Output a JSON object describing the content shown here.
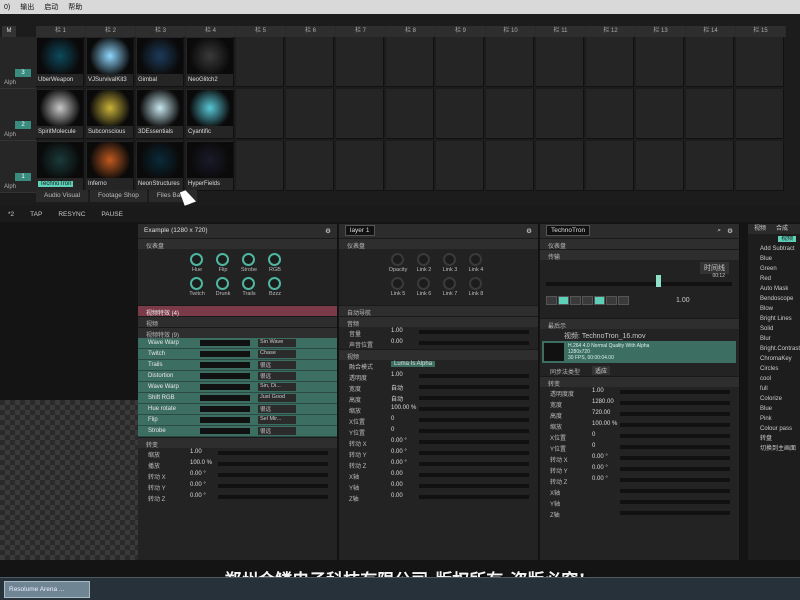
{
  "menubar": [
    "0)",
    "输出",
    "启动",
    "帮助"
  ],
  "grid": {
    "layer_label_M": "M",
    "columns": [
      "栏 1",
      "栏 2",
      "栏 3",
      "栏 4",
      "栏 5",
      "栏 6",
      "栏 7",
      "栏 8",
      "栏 9",
      "栏 10",
      "栏 11",
      "栏 12",
      "栏 13",
      "栏 14",
      "栏 15"
    ],
    "layers": [
      {
        "num": "3",
        "name": "Alph",
        "clips": [
          "UberWeapon",
          "VJSurvivalKit3",
          "Gimbal",
          "NeoGlitch2"
        ]
      },
      {
        "num": "2",
        "name": "Alph",
        "clips": [
          "SpiritMolecule",
          "Subconscious",
          "3DEssentials",
          "Cyantific"
        ]
      },
      {
        "num": "1",
        "name": "Alph",
        "clips": [
          "TechnoTron",
          "Inferno",
          "NeonStructures",
          "HyperFields"
        ]
      }
    ],
    "bottom_tabs": [
      "Audio Visual",
      "Footage Shop",
      "Files Bac..."
    ],
    "selected_clip": "TechnoTron",
    "hover_clip": "HyperFields"
  },
  "transport": {
    "bpm": "*2",
    "tap": "TAP",
    "resync": "RESYNC",
    "pause": "PAUSE"
  },
  "comp_panel": {
    "title": "Example (1280 x 720)",
    "dashboard": "仪表盘",
    "knobs": [
      "Hue",
      "Flip",
      "Strobe",
      "RGB",
      "Twitch",
      "Drunk",
      "Trails",
      "Bzzz"
    ],
    "sect_video_fx": "视频特效 (4)",
    "sect_video": "视频",
    "sect_fx9": "视频特效 (9)",
    "effects": [
      {
        "name": "Wave Warp",
        "val": "Sin Wave"
      },
      {
        "name": "Twitch",
        "val": "Chase"
      },
      {
        "name": "Trails",
        "val": "很远"
      },
      {
        "name": "Distortion",
        "val": "很远"
      },
      {
        "name": "Wave Warp",
        "val": "Sin, Di..."
      },
      {
        "name": "Shift RGB",
        "val": "Just Good"
      },
      {
        "name": "Hue rotate",
        "val": "很远"
      },
      {
        "name": "Flip",
        "val": "Sel Mir..."
      },
      {
        "name": "Strobe",
        "val": "很远"
      }
    ],
    "transform": "转变",
    "params": [
      {
        "k": "缩放",
        "v": "1.00"
      },
      {
        "k": "播放",
        "v": "100.0 %"
      },
      {
        "k": "转动 X",
        "v": "0.00 °"
      },
      {
        "k": "转动 Y",
        "v": "0.00 °"
      },
      {
        "k": "转动 Z",
        "v": "0.00 °"
      }
    ]
  },
  "layer_panel": {
    "title": "layer 1",
    "dashboard": "仪表盘",
    "links": [
      "Opacity",
      "Link 2",
      "Link 3",
      "Link 4",
      "Link 5",
      "Link 6",
      "Link 7",
      "Link 8"
    ],
    "sect_auto": "自动导航",
    "sect_audio": "音频",
    "audio": [
      {
        "k": "音量",
        "v": "1.00"
      },
      {
        "k": "声音位置",
        "v": "0.00"
      }
    ],
    "sect_video": "视频",
    "blend_label": "融合模式",
    "blend_val": "Luma Is Alpha",
    "video": [
      {
        "k": "透明度",
        "v": "1.00"
      },
      {
        "k": "宽度",
        "v": "自动"
      },
      {
        "k": "高度",
        "v": "自动"
      },
      {
        "k": "缩放",
        "v": "100.00 %"
      },
      {
        "k": "X位置",
        "v": "0"
      },
      {
        "k": "Y位置",
        "v": "0"
      },
      {
        "k": "转动 X",
        "v": "0.00 °"
      },
      {
        "k": "转动 Y",
        "v": "0.00 °"
      },
      {
        "k": "转动 Z",
        "v": "0.00 °"
      },
      {
        "k": "X轴",
        "v": "0.00"
      },
      {
        "k": "Y轴",
        "v": "0.00"
      },
      {
        "k": "Z轴",
        "v": "0.00"
      }
    ]
  },
  "clip_panel": {
    "title": "TechnoTron",
    "dashboard": "仪表盘",
    "transport": "传输",
    "time": "00:12",
    "mode": "时间线",
    "speed": "1.00",
    "sect_preview": "最后示",
    "file": "视频: TechnoTron_16.mov",
    "file_info": [
      "H.264 4.0 Normal Quality With Alpha",
      "1280x720",
      "30 FPS, 00:00:04.00"
    ],
    "fill": "同步法类型",
    "fill_val": "适应",
    "transform": "转变",
    "params": [
      {
        "k": "透明度度",
        "v": "1.00"
      },
      {
        "k": "宽度",
        "v": "1280.00"
      },
      {
        "k": "高度",
        "v": "720.00"
      },
      {
        "k": "缩放",
        "v": "100.00 %"
      },
      {
        "k": "X位置",
        "v": "0"
      },
      {
        "k": "Y位置",
        "v": "0"
      },
      {
        "k": "转动 X",
        "v": "0.00 °"
      },
      {
        "k": "转动 Y",
        "v": "0.00 °"
      },
      {
        "k": "转动 Z",
        "v": "0.00 °"
      },
      {
        "k": "X轴",
        "v": ""
      },
      {
        "k": "Y轴",
        "v": ""
      },
      {
        "k": "Z轴",
        "v": ""
      }
    ]
  },
  "effects_list": {
    "tabs": [
      "视频",
      "合成"
    ],
    "tag": "视频",
    "items": [
      "Add Subtract",
      "Blue",
      "Green",
      "Red",
      "Auto Mask",
      "Bendoscope",
      "Blow",
      "Bright Lines",
      "Solid",
      "Blur",
      "Bright.Contrast",
      "ChromaKey",
      "Circles",
      "cool",
      "full",
      "Colorize",
      "Blue",
      "Pink",
      "Colour pass",
      "转盘",
      "切换到主画面"
    ]
  },
  "taskbar": {
    "app": "Resolume Arena ..."
  },
  "watermark": "郑州金鳞电子科技有限公司-版权所有-盗版必究!",
  "colors": {
    "accent": "#5fd0b8",
    "effect_row": "#3d6e62",
    "fx_header": "#8a3d4c"
  }
}
